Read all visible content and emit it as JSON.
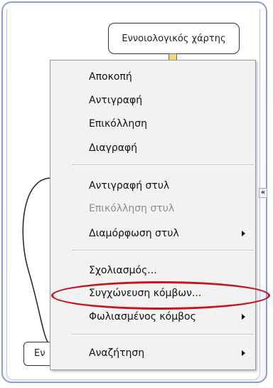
{
  "mindmap": {
    "top_node_label": "Εννοιολογικός χάρτης",
    "bottom_node_label": "Εν",
    "scroll_glyph": "«"
  },
  "context_menu": {
    "items": [
      {
        "label": "Αποκοπή",
        "enabled": true,
        "submenu": false
      },
      {
        "label": "Αντιγραφή",
        "enabled": true,
        "submenu": false
      },
      {
        "label": "Επικόλληση",
        "enabled": true,
        "submenu": false
      },
      {
        "label": "Διαγραφή",
        "enabled": true,
        "submenu": false
      },
      {
        "label": "Αντιγραφή στυλ",
        "enabled": true,
        "submenu": false
      },
      {
        "label": "Επικόλληση στυλ",
        "enabled": false,
        "submenu": false
      },
      {
        "label": "Διαμόρφωση στυλ",
        "enabled": true,
        "submenu": true
      },
      {
        "label": "Σχολιασμός...",
        "enabled": true,
        "submenu": false
      },
      {
        "label": "Συγχώνευση κόμβων...",
        "enabled": true,
        "submenu": false
      },
      {
        "label": "Φωλιασμένος κόμβος",
        "enabled": true,
        "submenu": true
      },
      {
        "label": "Αναζήτηση",
        "enabled": true,
        "submenu": true
      }
    ],
    "highlighted_item": "Συγχώνευση κόμβων..."
  },
  "colors": {
    "highlight_ring": "#c4161c",
    "frame_border": "#8f9bdc",
    "disabled_text": "#8d8d8d"
  }
}
